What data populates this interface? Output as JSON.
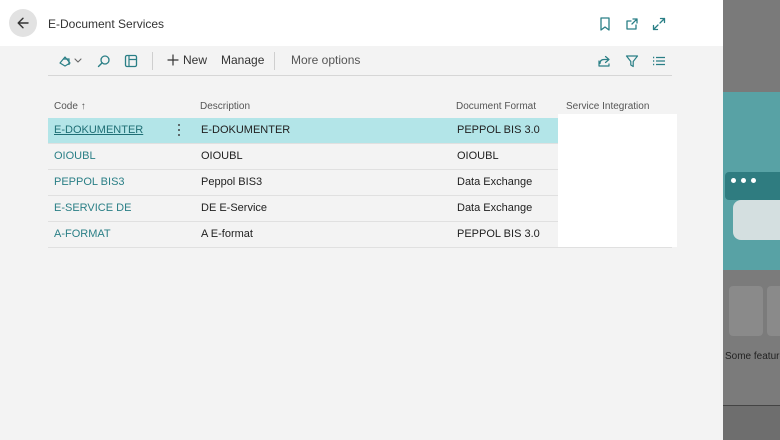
{
  "header": {
    "title": "E-Document Services"
  },
  "toolbar": {
    "new_label": "New",
    "manage_label": "Manage",
    "more_label": "More options"
  },
  "table": {
    "columns": {
      "code": "Code",
      "code_sort": "↑",
      "description": "Description",
      "document_format": "Document Format",
      "service_integration": "Service Integration"
    },
    "rows": [
      {
        "code": "E-DOKUMENTER",
        "description": "E-DOKUMENTER",
        "format": "PEPPOL BIS 3.0",
        "selected": true
      },
      {
        "code": "OIOUBL",
        "description": "OIOUBL",
        "format": "OIOUBL"
      },
      {
        "code": "PEPPOL BIS3",
        "description": "Peppol BIS3",
        "format": "Data Exchange"
      },
      {
        "code": "E-SERVICE DE",
        "description": "DE E-Service",
        "format": "Data Exchange"
      },
      {
        "code": "A-FORMAT",
        "description": "A E-format",
        "format": "PEPPOL BIS 3.0"
      }
    ]
  },
  "background": {
    "caption": "Some features"
  },
  "colors": {
    "accent": "#2a7f86",
    "selected_row": "#b3e5e8"
  },
  "icons": [
    "back-arrow-icon",
    "bookmark-icon",
    "open-new-window-icon",
    "expand-icon",
    "view-switch-icon",
    "search-icon",
    "filter-pane-icon",
    "plus-icon",
    "share-icon",
    "filter-icon",
    "list-icon"
  ]
}
